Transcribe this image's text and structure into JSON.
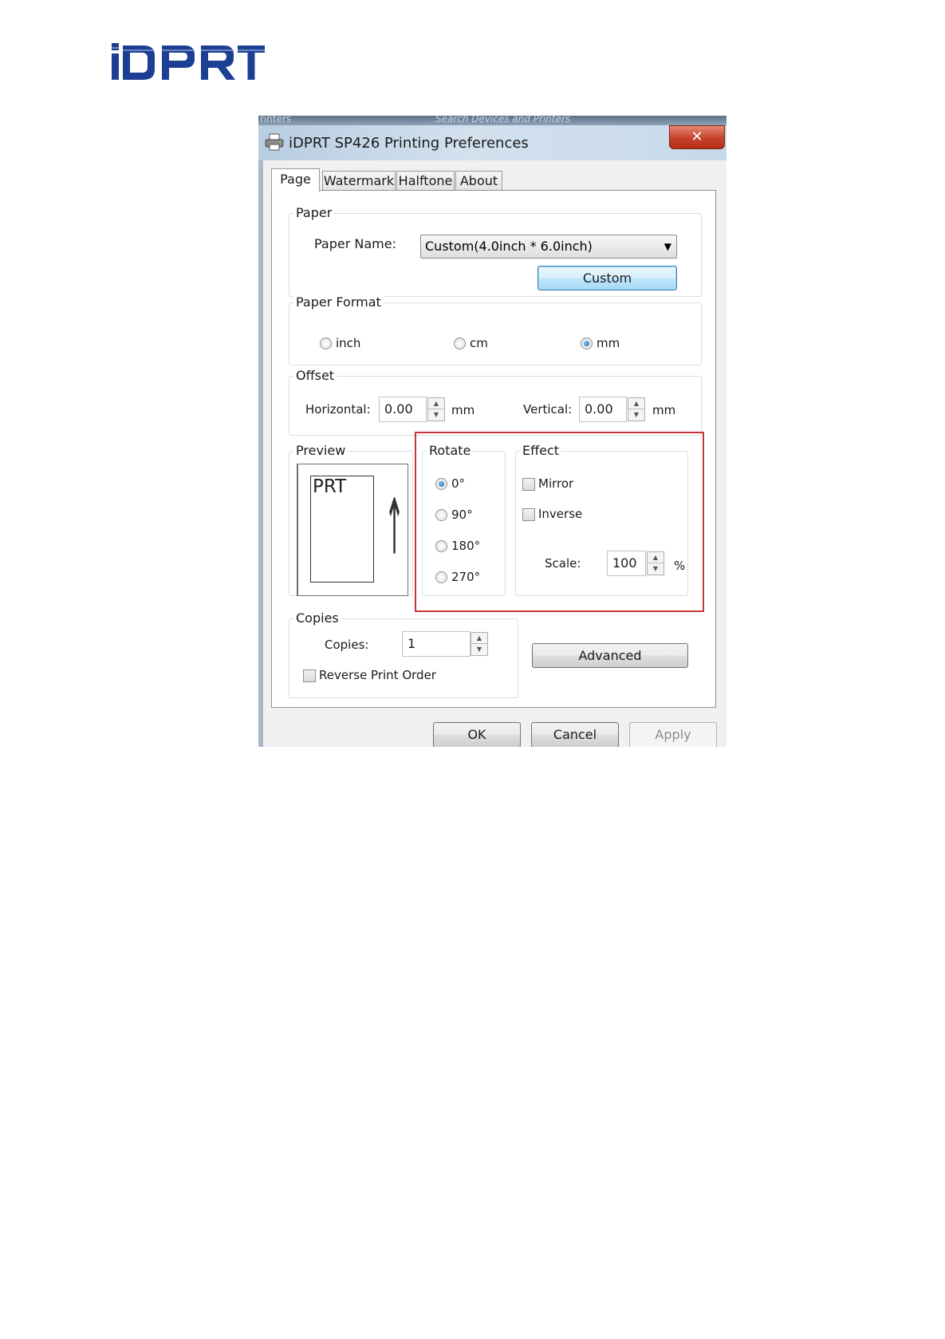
{
  "logo": {
    "text": "iDPRT"
  },
  "explorer": {
    "left_text": "rinters",
    "search_placeholder": "Search Devices and Printers"
  },
  "window": {
    "title": "iDPRT SP426 Printing Preferences",
    "close_glyph": "✕"
  },
  "tabs": [
    {
      "label": "Page",
      "active": true
    },
    {
      "label": "Watermark",
      "active": false
    },
    {
      "label": "Halftone",
      "active": false
    },
    {
      "label": "About",
      "active": false
    }
  ],
  "paper": {
    "legend": "Paper",
    "name_label": "Paper Name:",
    "name_value": "Custom(4.0inch * 6.0inch)",
    "custom_button": "Custom"
  },
  "paper_format": {
    "legend": "Paper Format",
    "options": [
      {
        "label": "inch",
        "selected": false
      },
      {
        "label": "cm",
        "selected": false
      },
      {
        "label": "mm",
        "selected": true
      }
    ]
  },
  "offset": {
    "legend": "Offset",
    "horizontal_label": "Horizontal:",
    "horizontal_value": "0.00",
    "horizontal_unit": "mm",
    "vertical_label": "Vertical:",
    "vertical_value": "0.00",
    "vertical_unit": "mm"
  },
  "preview": {
    "legend": "Preview",
    "page_text": "PRT",
    "arrow_glyph": "↑"
  },
  "rotate": {
    "legend": "Rotate",
    "options": [
      {
        "label": "0°",
        "selected": true
      },
      {
        "label": "90°",
        "selected": false
      },
      {
        "label": "180°",
        "selected": false
      },
      {
        "label": "270°",
        "selected": false
      }
    ]
  },
  "effect": {
    "legend": "Effect",
    "mirror_label": "Mirror",
    "mirror_checked": false,
    "inverse_label": "Inverse",
    "inverse_checked": false,
    "scale_label": "Scale:",
    "scale_value": "100",
    "scale_unit": "%"
  },
  "copies": {
    "legend": "Copies",
    "copies_label": "Copies:",
    "copies_value": "1",
    "reverse_label": "Reverse Print Order",
    "reverse_checked": false
  },
  "advanced_button": "Advanced",
  "footer": {
    "ok": "OK",
    "cancel": "Cancel",
    "apply": "Apply"
  },
  "colors": {
    "highlight": "#c9343a",
    "title_bar": "#c7d9ea",
    "close_button": "#c5412b"
  }
}
